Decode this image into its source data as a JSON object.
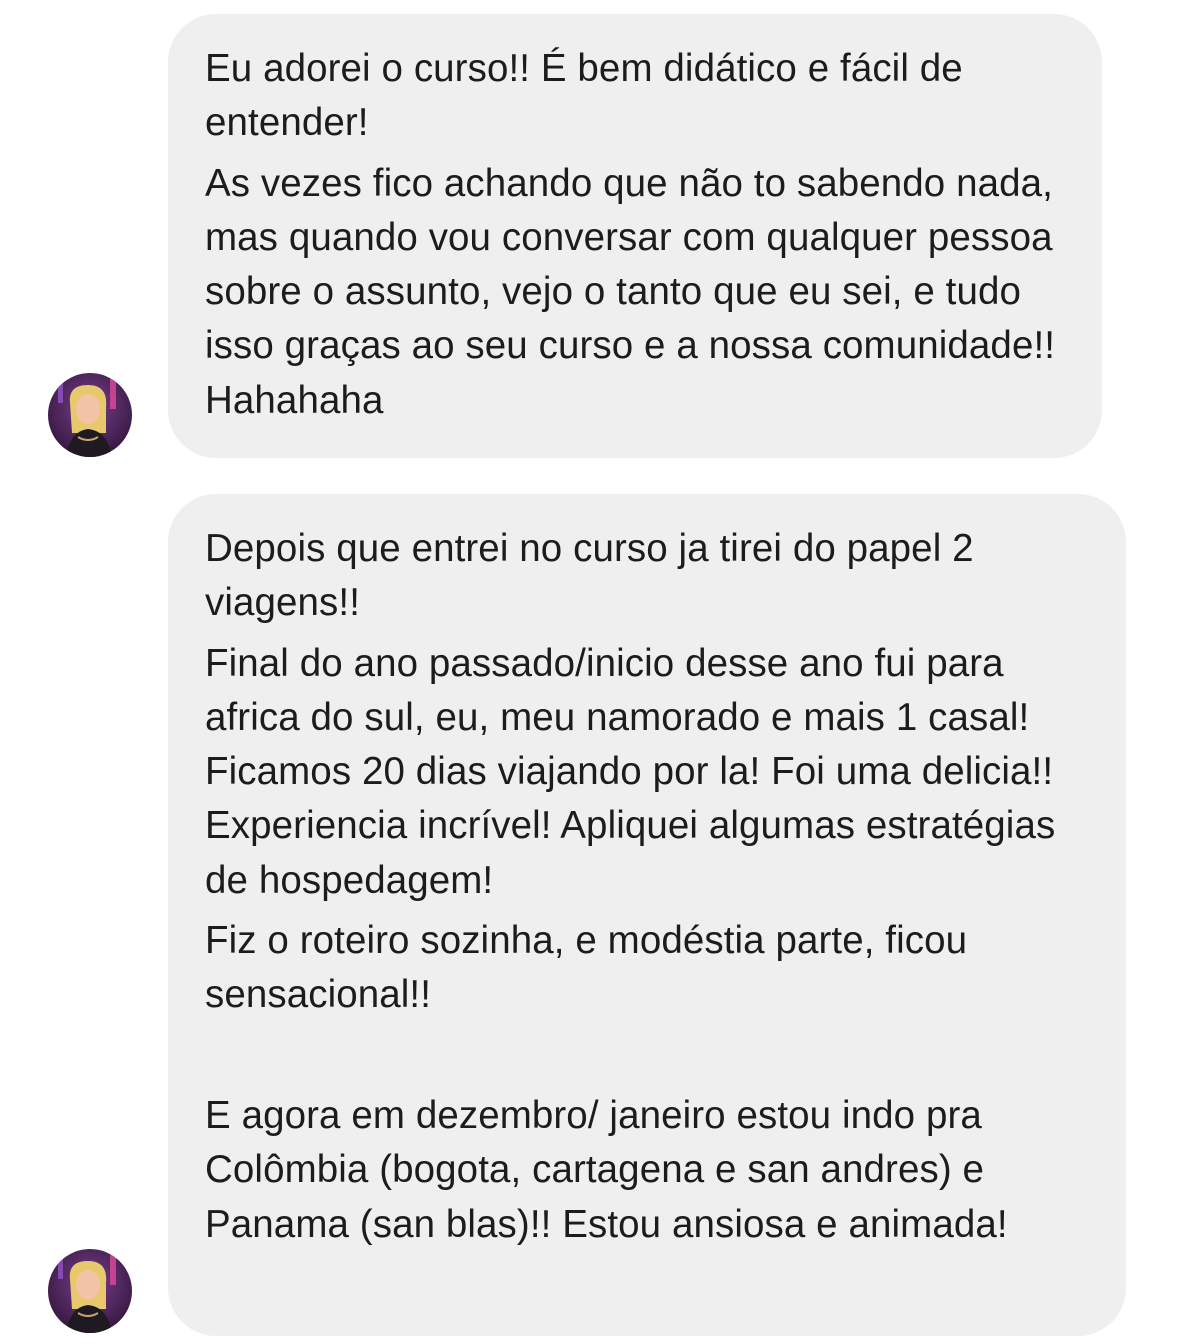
{
  "messages": [
    {
      "paragraphs": [
        "Eu adorei o curso!! É bem didático e fácil de entender!",
        "As vezes fico achando que não to sabendo nada, mas quando vou conversar com qualquer pessoa sobre o assunto, vejo o tanto que eu sei, e tudo isso graças ao seu curso e a nossa comunidade!! Hahahaha"
      ]
    },
    {
      "paragraphs": [
        "Depois que entrei no curso ja tirei do papel 2 viagens!!",
        "Final do ano passado/inicio desse ano fui para africa do sul, eu, meu namorado e mais 1 casal!  Ficamos 20 dias viajando por la! Foi uma delicia!! Experiencia incrível! Apliquei algumas estratégias de hospedagem!",
        "Fiz o roteiro sozinha, e modéstia parte, ficou sensacional!!",
        " ",
        "E agora em dezembro/ janeiro estou indo pra Colômbia (bogota, cartagena e san andres) e Panama (san blas)!! Estou ansiosa e animada!"
      ]
    }
  ],
  "colors": {
    "bubble_background": "#efeff0",
    "text": "#1c1c1e",
    "page_background": "#ffffff"
  },
  "icons": {
    "avatar": "profile-photo"
  }
}
